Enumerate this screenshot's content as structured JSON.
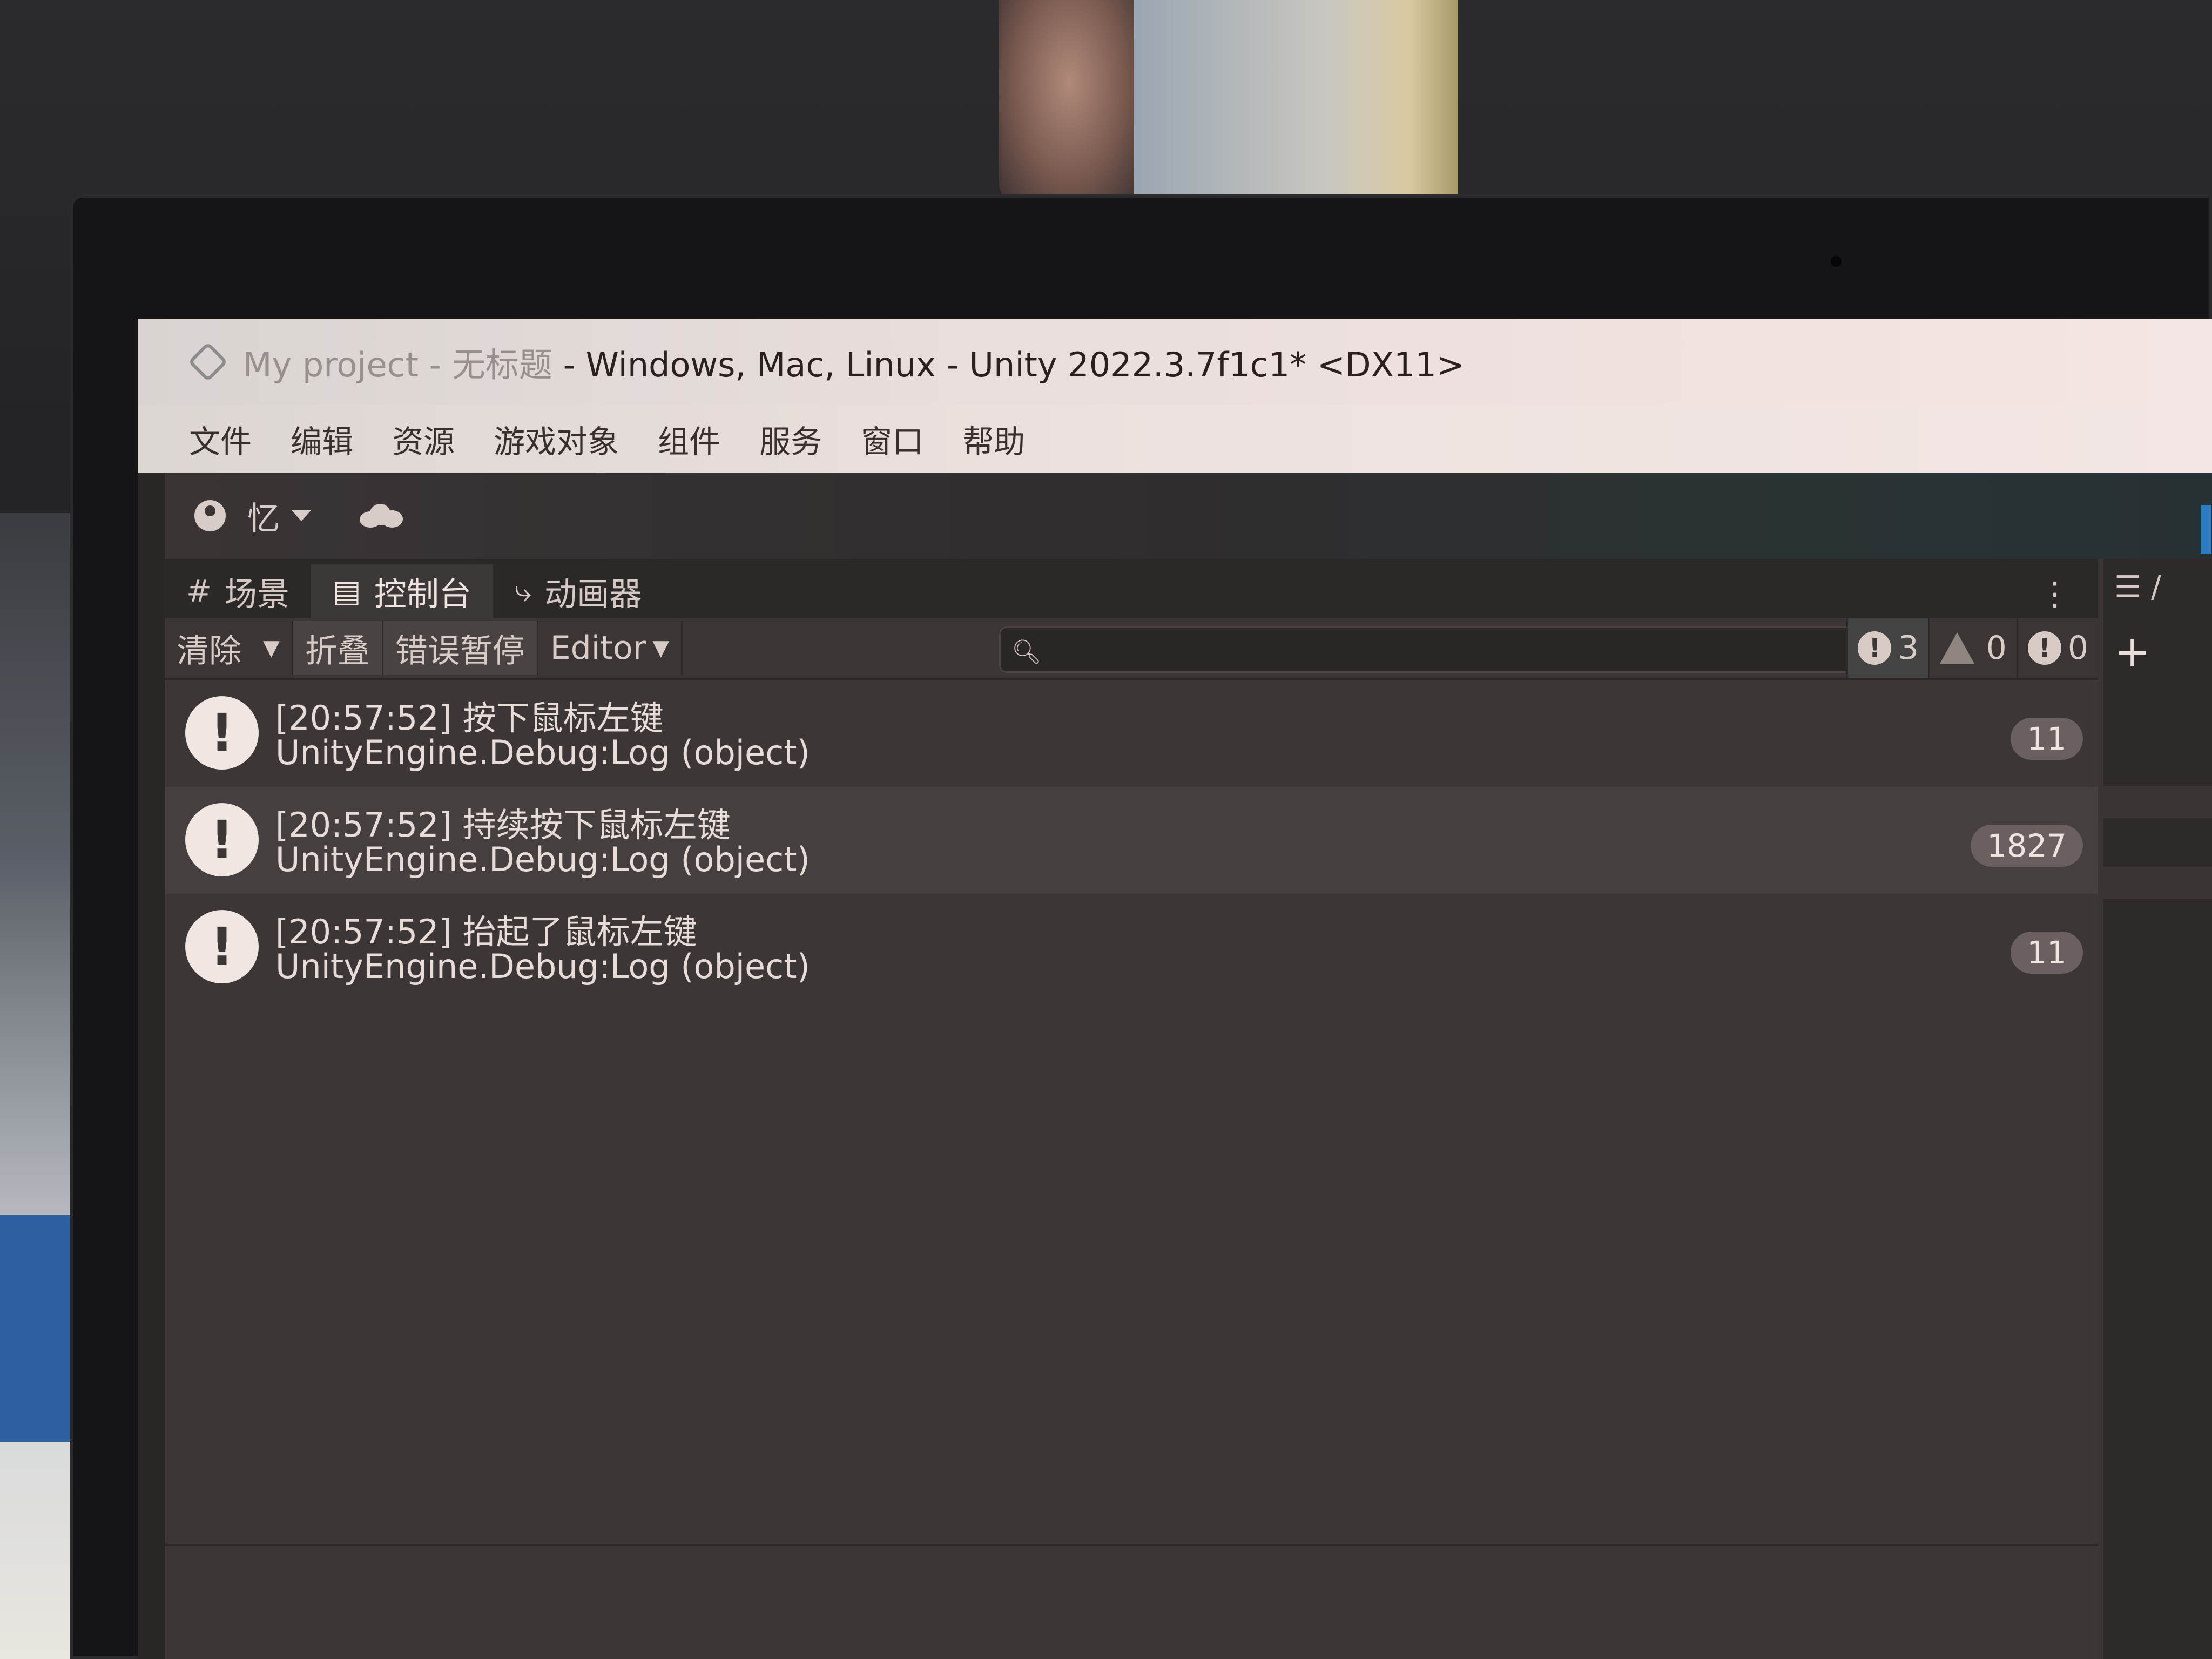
{
  "window": {
    "title_project": "My project",
    "title_scene": " - 无标题",
    "title_rest": " - Windows, Mac, Linux - Unity 2022.3.7f1c1* <DX11>"
  },
  "menu": [
    "文件",
    "编辑",
    "资源",
    "游戏对象",
    "组件",
    "服务",
    "窗口",
    "帮助"
  ],
  "toolbar": {
    "account_label": "忆"
  },
  "tabs": [
    {
      "label": "场景",
      "icon": "#",
      "active": false
    },
    {
      "label": "控制台",
      "icon": "▤",
      "active": true
    },
    {
      "label": "动画器",
      "icon": "⤷",
      "active": false
    }
  ],
  "console_toolbar": {
    "clear_label": "清除",
    "collapse_label": "折叠",
    "error_pause_label": "错误暂停",
    "editor_label": "Editor",
    "search_placeholder": "",
    "log_count": "3",
    "warning_count": "0",
    "error_count": "0"
  },
  "logs": [
    {
      "time": "[20:57:52]",
      "message": "按下鼠标左键",
      "source": "UnityEngine.Debug:Log (object)",
      "count": "11"
    },
    {
      "time": "[20:57:52]",
      "message": "持续按下鼠标左键",
      "source": "UnityEngine.Debug:Log (object)",
      "count": "1827"
    },
    {
      "time": "[20:57:52]",
      "message": "抬起了鼠标左键",
      "source": "UnityEngine.Debug:Log (object)",
      "count": "11"
    }
  ],
  "right_panel": {
    "tab_label": "☰ /"
  },
  "colors": {
    "editor_bg": "#3c3636",
    "titlebar_bg": "#ede2df",
    "accent_blue": "#2a7cc7"
  }
}
